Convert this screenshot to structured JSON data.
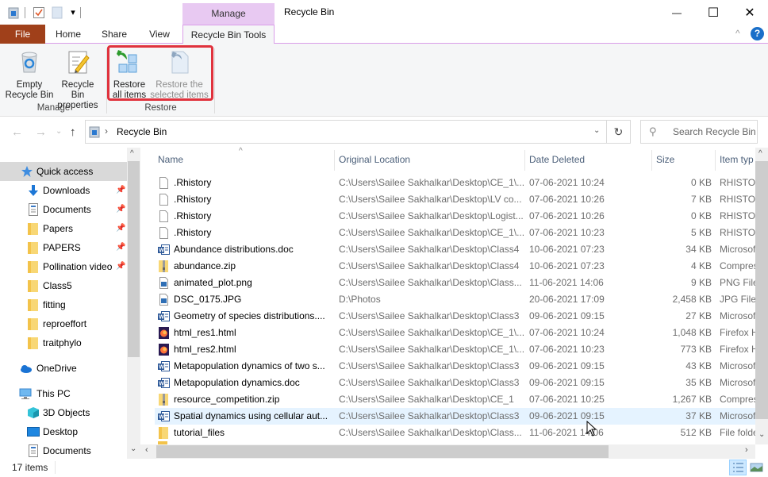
{
  "window": {
    "title": "Recycle Bin",
    "context_tab_group": "Manage",
    "minimize": "—",
    "maximize": "☐",
    "close": "✕"
  },
  "tabs": [
    {
      "label": "File"
    },
    {
      "label": "Home"
    },
    {
      "label": "Share"
    },
    {
      "label": "View"
    },
    {
      "label": "Recycle Bin Tools",
      "active": true
    }
  ],
  "ribbon": {
    "collapse_icon": "^",
    "help_icon": "?",
    "groups": [
      {
        "label": "Manage",
        "buttons": [
          {
            "line1": "Empty",
            "line2": "Recycle Bin",
            "icon": "recycle-bin-icon"
          },
          {
            "line1": "Recycle Bin",
            "line2": "properties",
            "icon": "properties-icon"
          }
        ]
      },
      {
        "label": "Restore",
        "buttons": [
          {
            "line1": "Restore",
            "line2": "all items",
            "icon": "restore-all-icon",
            "enabled": true
          },
          {
            "line1": "Restore the",
            "line2": "selected items",
            "icon": "restore-selected-icon",
            "enabled": false
          }
        ]
      }
    ],
    "highlight_color": "#e0323d"
  },
  "address": {
    "back": "←",
    "forward": "→",
    "recent": "⌄",
    "up": "↑",
    "separator": "›",
    "path": "Recycle Bin",
    "dropdown": "⌄",
    "refresh": "↻",
    "search_placeholder": "Search Recycle Bin",
    "search_icon": "⚲"
  },
  "nav": {
    "items": [
      {
        "label": "Quick access",
        "icon": "star",
        "selected": true
      },
      {
        "label": "Downloads",
        "icon": "download",
        "pinned": true
      },
      {
        "label": "Documents",
        "icon": "document",
        "pinned": true
      },
      {
        "label": "Papers",
        "icon": "folder",
        "pinned": true
      },
      {
        "label": "PAPERS",
        "icon": "folder",
        "pinned": true
      },
      {
        "label": "Pollination video",
        "icon": "folder",
        "pinned": true
      },
      {
        "label": "Class5",
        "icon": "folder"
      },
      {
        "label": "fitting",
        "icon": "folder"
      },
      {
        "label": "reproeffort",
        "icon": "folder"
      },
      {
        "label": "traitphylo",
        "icon": "folder"
      },
      {
        "label": "OneDrive",
        "icon": "cloud"
      },
      {
        "label": "This PC",
        "icon": "pc"
      },
      {
        "label": "3D Objects",
        "icon": "cube"
      },
      {
        "label": "Desktop",
        "icon": "desktop"
      },
      {
        "label": "Documents",
        "icon": "document"
      }
    ]
  },
  "columns": {
    "name": "Name",
    "location": "Original Location",
    "date": "Date Deleted",
    "size": "Size",
    "type": "Item typ"
  },
  "files": [
    {
      "name": ".Rhistory",
      "location": "C:\\Users\\Sailee Sakhalkar\\Desktop\\CE_1\\...",
      "date": "07-06-2021 10:24",
      "size": "0 KB",
      "type": "RHISTORY",
      "icon": "blank"
    },
    {
      "name": ".Rhistory",
      "location": "C:\\Users\\Sailee Sakhalkar\\Desktop\\LV co...",
      "date": "07-06-2021 10:26",
      "size": "7 KB",
      "type": "RHISTORY",
      "icon": "blank"
    },
    {
      "name": ".Rhistory",
      "location": "C:\\Users\\Sailee Sakhalkar\\Desktop\\Logist...",
      "date": "07-06-2021 10:26",
      "size": "0 KB",
      "type": "RHISTORY",
      "icon": "blank"
    },
    {
      "name": ".Rhistory",
      "location": "C:\\Users\\Sailee Sakhalkar\\Desktop\\CE_1\\...",
      "date": "07-06-2021 10:23",
      "size": "5 KB",
      "type": "RHISTORY",
      "icon": "blank"
    },
    {
      "name": "Abundance distributions.doc",
      "location": "C:\\Users\\Sailee Sakhalkar\\Desktop\\Class4",
      "date": "10-06-2021 07:23",
      "size": "34 KB",
      "type": "Microsoft",
      "icon": "word"
    },
    {
      "name": "abundance.zip",
      "location": "C:\\Users\\Sailee Sakhalkar\\Desktop\\Class4",
      "date": "10-06-2021 07:23",
      "size": "4 KB",
      "type": "Compressed",
      "icon": "zip"
    },
    {
      "name": "animated_plot.png",
      "location": "C:\\Users\\Sailee Sakhalkar\\Desktop\\Class...",
      "date": "11-06-2021 14:06",
      "size": "9 KB",
      "type": "PNG File",
      "icon": "image"
    },
    {
      "name": "DSC_0175.JPG",
      "location": "D:\\Photos",
      "date": "20-06-2021 17:09",
      "size": "2,458 KB",
      "type": "JPG File",
      "icon": "image"
    },
    {
      "name": "Geometry of species distributions....",
      "location": "C:\\Users\\Sailee Sakhalkar\\Desktop\\Class3",
      "date": "09-06-2021 09:15",
      "size": "27 KB",
      "type": "Microsoft",
      "icon": "word"
    },
    {
      "name": "html_res1.html",
      "location": "C:\\Users\\Sailee Sakhalkar\\Desktop\\CE_1\\...",
      "date": "07-06-2021 10:24",
      "size": "1,048 KB",
      "type": "Firefox HTML",
      "icon": "firefox"
    },
    {
      "name": "html_res2.html",
      "location": "C:\\Users\\Sailee Sakhalkar\\Desktop\\CE_1\\...",
      "date": "07-06-2021 10:23",
      "size": "773 KB",
      "type": "Firefox HTML",
      "icon": "firefox"
    },
    {
      "name": "Metapopulation dynamics of two s...",
      "location": "C:\\Users\\Sailee Sakhalkar\\Desktop\\Class3",
      "date": "09-06-2021 09:15",
      "size": "43 KB",
      "type": "Microsoft",
      "icon": "word"
    },
    {
      "name": "Metapopulation dynamics.doc",
      "location": "C:\\Users\\Sailee Sakhalkar\\Desktop\\Class3",
      "date": "09-06-2021 09:15",
      "size": "35 KB",
      "type": "Microsoft",
      "icon": "word"
    },
    {
      "name": "resource_competition.zip",
      "location": "C:\\Users\\Sailee Sakhalkar\\Desktop\\CE_1",
      "date": "07-06-2021 10:25",
      "size": "1,267 KB",
      "type": "Compressed",
      "icon": "zip"
    },
    {
      "name": "Spatial dynamics using cellular aut...",
      "location": "C:\\Users\\Sailee Sakhalkar\\Desktop\\Class3",
      "date": "09-06-2021 09:15",
      "size": "37 KB",
      "type": "Microsoft",
      "icon": "word",
      "hovered": true
    },
    {
      "name": "tutorial_files",
      "location": "C:\\Users\\Sailee Sakhalkar\\Desktop\\Class...",
      "date": "11-06-2021 14:06",
      "size": "512 KB",
      "type": "File folder",
      "icon": "folder"
    }
  ],
  "status": {
    "item_count": "17 items"
  }
}
